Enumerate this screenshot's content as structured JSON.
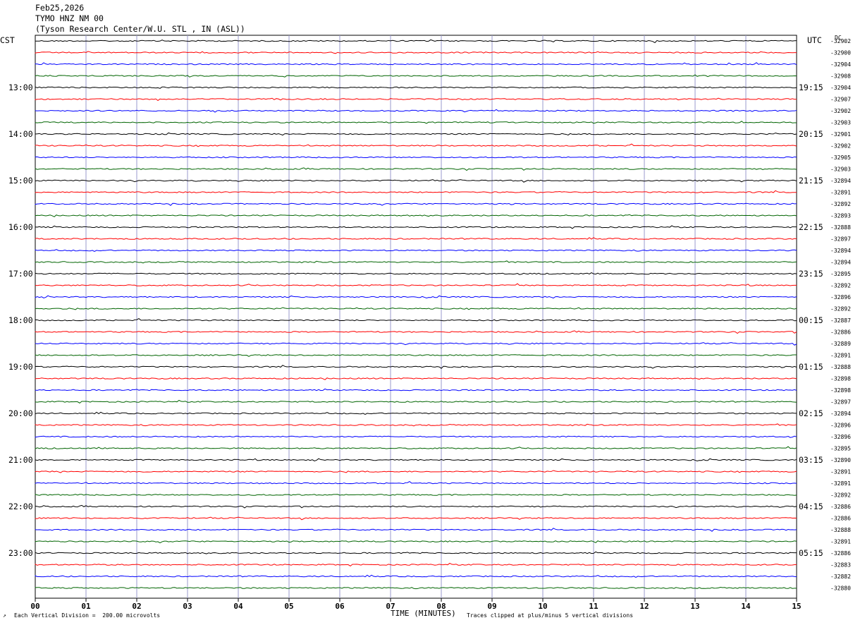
{
  "header": {
    "date": "Feb25,2026",
    "station": "TYMO HNZ NM 00",
    "location": "(Tyson Research Center/W.U. STL , IN (ASL))"
  },
  "left_tz": "CST",
  "right_tz": "UTC",
  "dc_label": "DC",
  "footer": {
    "scale_note": "Each Vertical Division =  200.00 microvolts",
    "x_title": "TIME (MINUTES)",
    "clip_note": "Traces clipped at plus/minus 5 vertical divisions"
  },
  "colors": {
    "black": "#000000",
    "red": "#ff0000",
    "blue": "#0000ff",
    "green": "#006400",
    "grid_v": "#9999cc"
  },
  "chart_data": {
    "type": "line",
    "title": "",
    "xlabel": "TIME (MINUTES)",
    "ylabel": "",
    "xlim": [
      0,
      15
    ],
    "x_ticks": [
      "00",
      "01",
      "02",
      "03",
      "04",
      "05",
      "06",
      "07",
      "08",
      "09",
      "10",
      "11",
      "12",
      "13",
      "14",
      "15"
    ],
    "trace_colors": [
      "black",
      "red",
      "blue",
      "green"
    ],
    "grid": true,
    "left_hour_labels": [
      "13:00",
      "14:00",
      "15:00",
      "16:00",
      "17:00",
      "18:00",
      "19:00",
      "20:00",
      "21:00",
      "22:00",
      "23:00"
    ],
    "right_hour_labels": [
      "19:15",
      "20:15",
      "21:15",
      "22:15",
      "23:15",
      "00:15",
      "01:15",
      "02:15",
      "03:15",
      "04:15",
      "05:15"
    ],
    "dc_offsets": [
      "-32902",
      "-32900",
      "-32904",
      "-32908",
      "-32904",
      "-32907",
      "-32902",
      "-32903",
      "-32901",
      "-32902",
      "-32905",
      "-32903",
      "-32894",
      "-32891",
      "-32892",
      "-32893",
      "-32888",
      "-32897",
      "-32894",
      "-32894",
      "-32895",
      "-32892",
      "-32896",
      "-32892",
      "-32887",
      "-32886",
      "-32889",
      "-32891",
      "-32888",
      "-32898",
      "-32898",
      "-32897",
      "-32894",
      "-32896",
      "-32896",
      "-32895",
      "-32890",
      "-32891",
      "-32891",
      "-32892",
      "-32886",
      "-32886",
      "-32888",
      "-32891",
      "-32886",
      "-32883",
      "-32882",
      "-32880"
    ]
  }
}
